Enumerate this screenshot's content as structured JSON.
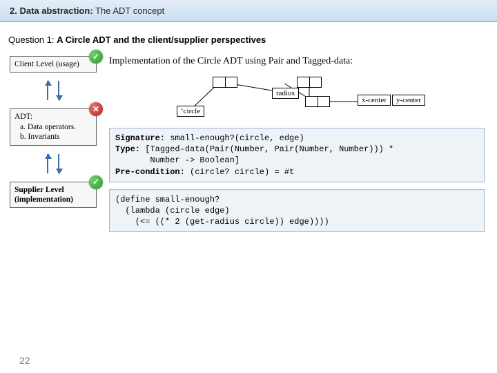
{
  "header": {
    "num": "2. Data abstraction:",
    "tail": " The ADT concept"
  },
  "question": {
    "label": "Question 1",
    "sep": ": ",
    "title": " A Circle ADT and the client/supplier perspectives"
  },
  "levels": {
    "client": "Client Level (usage)",
    "adt_title": "ADT:",
    "adt_a": "a. Data operators.",
    "adt_b": "b. Invariants",
    "supplier_l1": "Supplier Level",
    "supplier_l2": "(implementation)"
  },
  "impl_line": "Implementation of the Circle ADT using Pair and Tagged-data:",
  "tree": {
    "tag": "‘circle",
    "radius": "radius",
    "xc": "x-center",
    "yc": "y-center"
  },
  "code1": {
    "sig_kw": "Signature:",
    "sig_v": " small-enough?(circle, edge)",
    "type_kw": "Type:",
    "type_v": " [Tagged-data(Pair(Number, Pair(Number, Number))) *\n       Number -> Boolean]",
    "pre_kw": "Pre-condition:",
    "pre_v": " (circle? circle) = #t"
  },
  "code2": "(define small-enough?\n  (lambda (circle edge)\n    (<= ((* 2 (get-radius circle)) edge))))",
  "page": "22"
}
